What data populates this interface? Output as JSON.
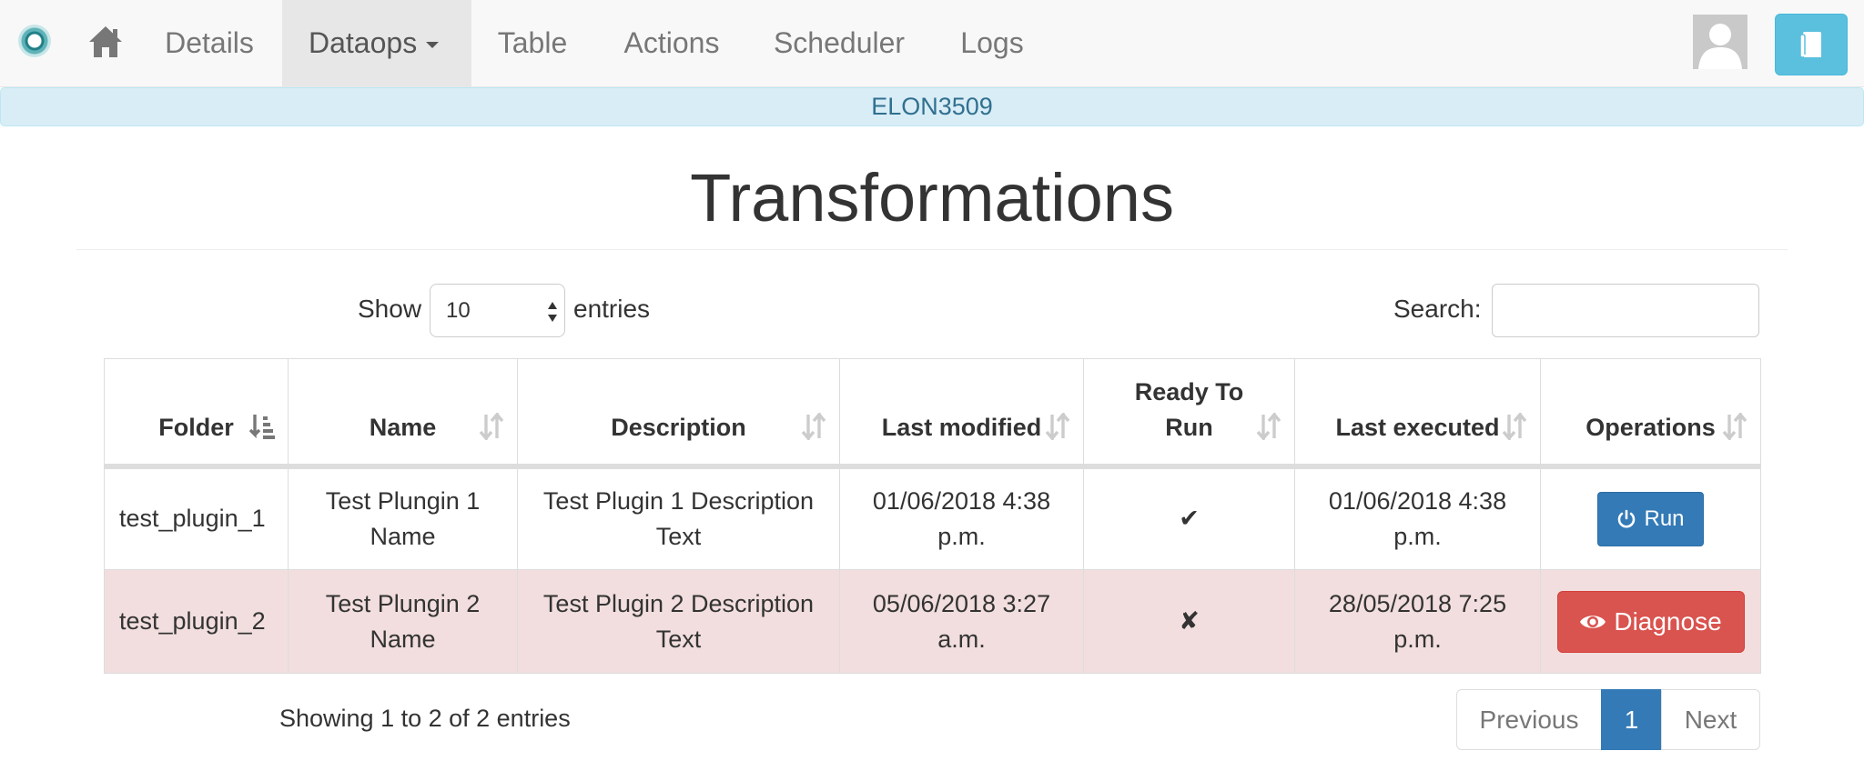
{
  "nav": {
    "items": [
      {
        "label": "Details"
      },
      {
        "label": "Dataops",
        "active": true
      },
      {
        "label": "Table"
      },
      {
        "label": "Actions"
      },
      {
        "label": "Scheduler"
      },
      {
        "label": "Logs"
      }
    ],
    "icons": [
      "brand-logo",
      "home-icon",
      "user-avatar",
      "book-icon"
    ]
  },
  "banner": {
    "text": "ELON3509",
    "color": "#31708f",
    "background": "#d9edf7"
  },
  "page": {
    "title": "Transformations"
  },
  "controls": {
    "show_label": "Show",
    "length_value": "10",
    "entries_label": "entries",
    "search_label": "Search:",
    "search_value": ""
  },
  "table": {
    "columns": [
      {
        "label": "Folder",
        "sorted": "asc"
      },
      {
        "label": "Name"
      },
      {
        "label": "Description"
      },
      {
        "label": "Last modified"
      },
      {
        "label": "Ready To Run"
      },
      {
        "label": "Last executed"
      },
      {
        "label": "Operations"
      }
    ],
    "rows": [
      {
        "folder": "test_plugin_1",
        "name": "Test Plungin 1 Name",
        "description": "Test Plugin 1 Description Text",
        "last_modified": "01/06/2018 4:38 p.m.",
        "ready": "✔",
        "last_executed": "01/06/2018 4:38 p.m.",
        "operation": "Run",
        "status": "ok"
      },
      {
        "folder": "test_plugin_2",
        "name": "Test Plungin 2 Name",
        "description": "Test Plugin 2 Description Text",
        "last_modified": "05/06/2018 3:27 a.m.",
        "ready": "✘",
        "last_executed": "28/05/2018 7:25 p.m.",
        "operation": "Diagnose",
        "status": "danger"
      }
    ]
  },
  "footer": {
    "info": "Showing 1 to 2 of 2 entries",
    "pagination": {
      "previous": "Previous",
      "current": "1",
      "next": "Next"
    }
  },
  "colors": {
    "primary": "#337ab7",
    "danger": "#d9534f",
    "danger_row": "#f2dede",
    "info_button": "#5bc0de"
  }
}
